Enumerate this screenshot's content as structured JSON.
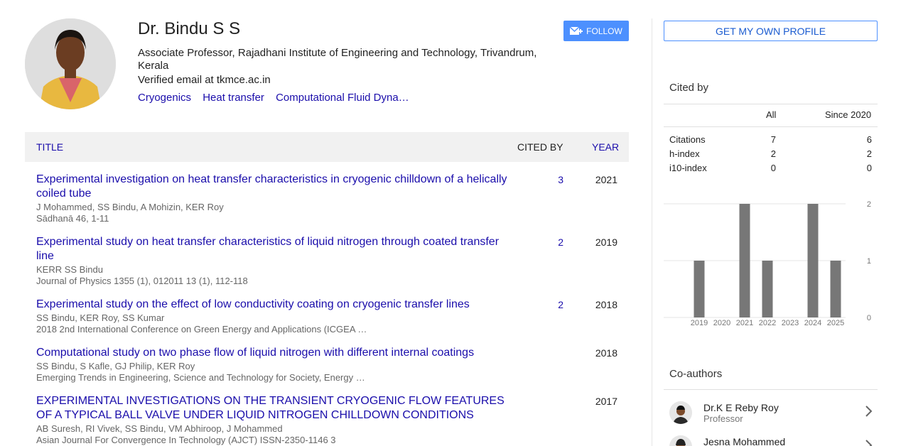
{
  "profile": {
    "name": "Dr. Bindu S S",
    "affiliation": "Associate Professor, Rajadhani Institute of Engineering and Technology, Trivandrum, Kerala",
    "email": "Verified email at tkmce.ac.in",
    "interests": [
      "Cryogenics",
      "Heat transfer",
      "Computational Fluid Dyna…"
    ],
    "follow_label": "FOLLOW"
  },
  "table": {
    "headers": {
      "title": "TITLE",
      "cited_by": "CITED BY",
      "year": "YEAR"
    },
    "articles": [
      {
        "title": "Experimental investigation on heat transfer characteristics in cryogenic chilldown of a helically coiled tube",
        "authors": "J Mohammed, SS Bindu, A Mohizin, KER Roy",
        "venue": "Sādhanā 46, 1-11",
        "cited_by": "3",
        "year": "2021"
      },
      {
        "title": "Experimental study on heat transfer characteristics of liquid nitrogen through coated transfer line",
        "authors": "KERR SS Bindu",
        "venue": "Journal of Physics 1355 (1), 012011 13 (1), 112-118",
        "cited_by": "2",
        "year": "2019"
      },
      {
        "title": "Experimental study on the effect of low conductivity coating on cryogenic transfer lines",
        "authors": "SS Bindu, KER Roy, SS Kumar",
        "venue": "2018 2nd International Conference on Green Energy and Applications (ICGEA …",
        "cited_by": "2",
        "year": "2018"
      },
      {
        "title": "Computational study on two phase flow of liquid nitrogen with different internal coatings",
        "authors": "SS Bindu, S Kafle, GJ Philip, KER Roy",
        "venue": "Emerging Trends in Engineering, Science and Technology for Society, Energy …",
        "cited_by": "",
        "year": "2018"
      },
      {
        "title": "EXPERIMENTAL INVESTIGATIONS ON THE TRANSIENT CRYOGENIC FLOW FEATURES OF A TYPICAL BALL VALVE UNDER LIQUID NITROGEN CHILLDOWN CONDITIONS",
        "authors": "AB Suresh, RI Vivek, SS Bindu, VM Abhiroop, J Mohammed",
        "venue": "Asian Journal For Convergence In Technology (AJCT) ISSN-2350-1146 3",
        "cited_by": "",
        "year": "2017"
      }
    ]
  },
  "sidebar": {
    "get_profile_label": "GET MY OWN PROFILE",
    "cited_by_title": "Cited by",
    "stats_headers": {
      "all": "All",
      "since": "Since 2020"
    },
    "stats": [
      {
        "label": "Citations",
        "all": "7",
        "since": "6"
      },
      {
        "label": "h-index",
        "all": "2",
        "since": "2"
      },
      {
        "label": "i10-index",
        "all": "0",
        "since": "0"
      }
    ],
    "coauthors_title": "Co-authors",
    "coauthors": [
      {
        "name": "Dr.K E Reby Roy",
        "role": "Professor"
      },
      {
        "name": "Jesna Mohammed",
        "role": ""
      }
    ]
  },
  "chart_data": {
    "type": "bar",
    "categories": [
      "2019",
      "2020",
      "2021",
      "2022",
      "2023",
      "2024",
      "2025"
    ],
    "values": [
      1,
      0,
      2,
      1,
      0,
      2,
      1
    ],
    "ylim": [
      0,
      2
    ],
    "yticks": [
      "2",
      "1",
      "0"
    ],
    "grid": true,
    "bar_color": "#777777"
  },
  "colors": {
    "link": "#1a0dab",
    "accent": "#4d90fe"
  }
}
